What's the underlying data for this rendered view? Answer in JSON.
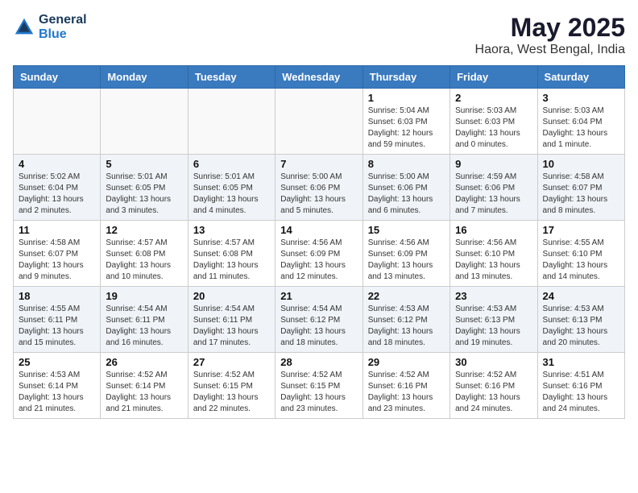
{
  "logo": {
    "line1": "General",
    "line2": "Blue"
  },
  "title": "May 2025",
  "subtitle": "Haora, West Bengal, India",
  "days_of_week": [
    "Sunday",
    "Monday",
    "Tuesday",
    "Wednesday",
    "Thursday",
    "Friday",
    "Saturday"
  ],
  "weeks": [
    [
      {
        "day": "",
        "info": ""
      },
      {
        "day": "",
        "info": ""
      },
      {
        "day": "",
        "info": ""
      },
      {
        "day": "",
        "info": ""
      },
      {
        "day": "1",
        "info": "Sunrise: 5:04 AM\nSunset: 6:03 PM\nDaylight: 12 hours and 59 minutes."
      },
      {
        "day": "2",
        "info": "Sunrise: 5:03 AM\nSunset: 6:03 PM\nDaylight: 13 hours and 0 minutes."
      },
      {
        "day": "3",
        "info": "Sunrise: 5:03 AM\nSunset: 6:04 PM\nDaylight: 13 hours and 1 minute."
      }
    ],
    [
      {
        "day": "4",
        "info": "Sunrise: 5:02 AM\nSunset: 6:04 PM\nDaylight: 13 hours and 2 minutes."
      },
      {
        "day": "5",
        "info": "Sunrise: 5:01 AM\nSunset: 6:05 PM\nDaylight: 13 hours and 3 minutes."
      },
      {
        "day": "6",
        "info": "Sunrise: 5:01 AM\nSunset: 6:05 PM\nDaylight: 13 hours and 4 minutes."
      },
      {
        "day": "7",
        "info": "Sunrise: 5:00 AM\nSunset: 6:06 PM\nDaylight: 13 hours and 5 minutes."
      },
      {
        "day": "8",
        "info": "Sunrise: 5:00 AM\nSunset: 6:06 PM\nDaylight: 13 hours and 6 minutes."
      },
      {
        "day": "9",
        "info": "Sunrise: 4:59 AM\nSunset: 6:06 PM\nDaylight: 13 hours and 7 minutes."
      },
      {
        "day": "10",
        "info": "Sunrise: 4:58 AM\nSunset: 6:07 PM\nDaylight: 13 hours and 8 minutes."
      }
    ],
    [
      {
        "day": "11",
        "info": "Sunrise: 4:58 AM\nSunset: 6:07 PM\nDaylight: 13 hours and 9 minutes."
      },
      {
        "day": "12",
        "info": "Sunrise: 4:57 AM\nSunset: 6:08 PM\nDaylight: 13 hours and 10 minutes."
      },
      {
        "day": "13",
        "info": "Sunrise: 4:57 AM\nSunset: 6:08 PM\nDaylight: 13 hours and 11 minutes."
      },
      {
        "day": "14",
        "info": "Sunrise: 4:56 AM\nSunset: 6:09 PM\nDaylight: 13 hours and 12 minutes."
      },
      {
        "day": "15",
        "info": "Sunrise: 4:56 AM\nSunset: 6:09 PM\nDaylight: 13 hours and 13 minutes."
      },
      {
        "day": "16",
        "info": "Sunrise: 4:56 AM\nSunset: 6:10 PM\nDaylight: 13 hours and 13 minutes."
      },
      {
        "day": "17",
        "info": "Sunrise: 4:55 AM\nSunset: 6:10 PM\nDaylight: 13 hours and 14 minutes."
      }
    ],
    [
      {
        "day": "18",
        "info": "Sunrise: 4:55 AM\nSunset: 6:11 PM\nDaylight: 13 hours and 15 minutes."
      },
      {
        "day": "19",
        "info": "Sunrise: 4:54 AM\nSunset: 6:11 PM\nDaylight: 13 hours and 16 minutes."
      },
      {
        "day": "20",
        "info": "Sunrise: 4:54 AM\nSunset: 6:11 PM\nDaylight: 13 hours and 17 minutes."
      },
      {
        "day": "21",
        "info": "Sunrise: 4:54 AM\nSunset: 6:12 PM\nDaylight: 13 hours and 18 minutes."
      },
      {
        "day": "22",
        "info": "Sunrise: 4:53 AM\nSunset: 6:12 PM\nDaylight: 13 hours and 18 minutes."
      },
      {
        "day": "23",
        "info": "Sunrise: 4:53 AM\nSunset: 6:13 PM\nDaylight: 13 hours and 19 minutes."
      },
      {
        "day": "24",
        "info": "Sunrise: 4:53 AM\nSunset: 6:13 PM\nDaylight: 13 hours and 20 minutes."
      }
    ],
    [
      {
        "day": "25",
        "info": "Sunrise: 4:53 AM\nSunset: 6:14 PM\nDaylight: 13 hours and 21 minutes."
      },
      {
        "day": "26",
        "info": "Sunrise: 4:52 AM\nSunset: 6:14 PM\nDaylight: 13 hours and 21 minutes."
      },
      {
        "day": "27",
        "info": "Sunrise: 4:52 AM\nSunset: 6:15 PM\nDaylight: 13 hours and 22 minutes."
      },
      {
        "day": "28",
        "info": "Sunrise: 4:52 AM\nSunset: 6:15 PM\nDaylight: 13 hours and 23 minutes."
      },
      {
        "day": "29",
        "info": "Sunrise: 4:52 AM\nSunset: 6:16 PM\nDaylight: 13 hours and 23 minutes."
      },
      {
        "day": "30",
        "info": "Sunrise: 4:52 AM\nSunset: 6:16 PM\nDaylight: 13 hours and 24 minutes."
      },
      {
        "day": "31",
        "info": "Sunrise: 4:51 AM\nSunset: 6:16 PM\nDaylight: 13 hours and 24 minutes."
      }
    ]
  ]
}
